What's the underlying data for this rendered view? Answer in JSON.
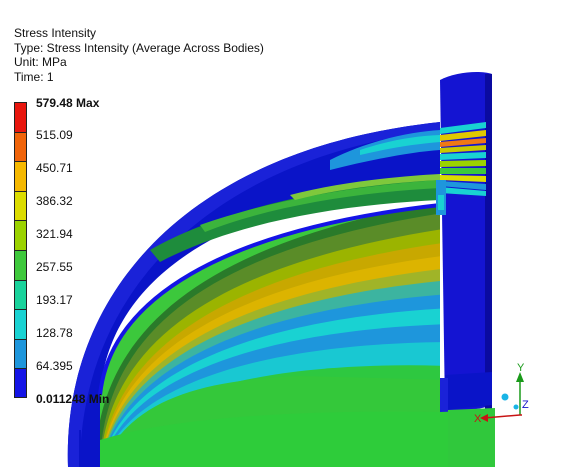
{
  "result": {
    "title": "Stress Intensity",
    "type_line": "Type: Stress Intensity (Average Across Bodies)",
    "unit_line": "Unit: MPa",
    "time_line": "Time: 1"
  },
  "legend": {
    "max_label": "579.48 Max",
    "min_label": "0.011248 Min",
    "ticks": [
      "515.09",
      "450.71",
      "386.32",
      "321.94",
      "257.55",
      "193.17",
      "128.78",
      "64.395"
    ],
    "colors": [
      "#e8160e",
      "#f0640a",
      "#f5b800",
      "#dcdc00",
      "#9bd200",
      "#3ec83c",
      "#19d29b",
      "#19d2d2",
      "#1e96dc",
      "#1414e6"
    ]
  },
  "triad": {
    "y_label": "Y",
    "z_label": "Z",
    "x_label": "X"
  }
}
